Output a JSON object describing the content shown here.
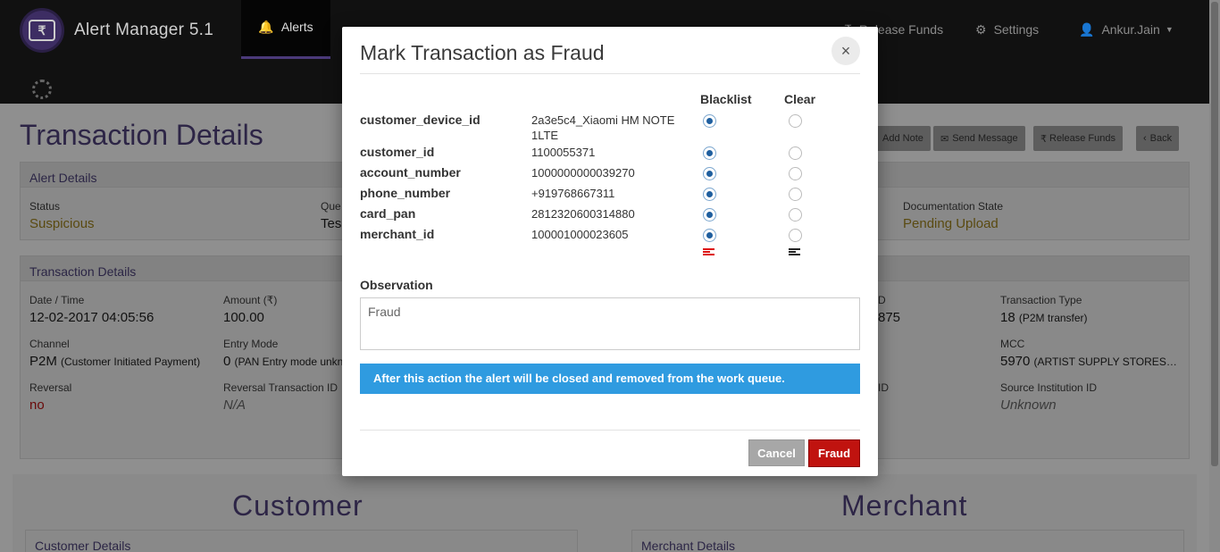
{
  "app": {
    "title": "Alert Manager 5.1",
    "logo_glyph": "₹"
  },
  "nav": {
    "alerts": "Alerts",
    "release_funds": "Release Funds",
    "settings": "Settings",
    "user": "Ankur.Jain"
  },
  "page": {
    "title": "Transaction Details",
    "actions": {
      "add_note": "Add Note",
      "send_message": "Send Message",
      "release_funds": "Release Funds",
      "back": "Back"
    }
  },
  "alert_details": {
    "heading": "Alert Details",
    "status_label": "Status",
    "status_value": "Suspicious",
    "queue_label": "Que",
    "queue_value": "Tes",
    "doc_state_label": "Documentation State",
    "doc_state_value": "Pending Upload"
  },
  "transaction_details": {
    "heading": "Transaction Details",
    "date_label": "Date / Time",
    "date_value": "12-02-2017 04:05:56",
    "amount_label": "Amount (₹)",
    "amount_value": "100.00",
    "type_label": "Transaction Type",
    "type_code": "18",
    "type_desc": "(P2M transfer)",
    "partial_label": "D",
    "partial_value": "875",
    "channel_label": "Channel",
    "channel_code": "P2M",
    "channel_desc": "(Customer Initiated Payment)",
    "entry_label": "Entry Mode",
    "entry_code": "0",
    "entry_desc": "(PAN Entry mode unkn",
    "mcc_label": "MCC",
    "mcc_code": "5970",
    "mcc_desc": "(ARTIST SUPPLY STORES…",
    "reversal_label": "Reversal",
    "reversal_value": "no",
    "rev_txn_label": "Reversal Transaction ID",
    "rev_txn_value": "N/A",
    "partial_id_label": "ID",
    "source_label": "Source Institution ID",
    "source_value": "Unknown"
  },
  "sections": {
    "customer": "Customer",
    "customer_details": "Customer Details",
    "merchant": "Merchant",
    "merchant_details": "Merchant Details"
  },
  "modal": {
    "title": "Mark Transaction as Fraud",
    "close": "×",
    "col_blacklist": "Blacklist",
    "col_clear": "Clear",
    "rows": [
      {
        "key": "customer_device_id",
        "value": "2a3e5c4_Xiaomi HM NOTE 1LTE",
        "selected": "blacklist"
      },
      {
        "key": "customer_id",
        "value": "1100055371",
        "selected": "blacklist"
      },
      {
        "key": "account_number",
        "value": "1000000000039270",
        "selected": "blacklist"
      },
      {
        "key": "phone_number",
        "value": "+919768667311",
        "selected": "blacklist"
      },
      {
        "key": "card_pan",
        "value": "2812320600314880",
        "selected": "blacklist"
      },
      {
        "key": "merchant_id",
        "value": "100001000023605",
        "selected": "blacklist"
      }
    ],
    "observation_label": "Observation",
    "observation_value": "Fraud",
    "info": "After this action the alert will be closed and removed from the work queue.",
    "cancel": "Cancel",
    "confirm": "Fraud"
  },
  "colors": {
    "brand": "#3d2d63",
    "info": "#2f9be0",
    "danger": "#c0130f",
    "radio": "#1f5f9f"
  }
}
